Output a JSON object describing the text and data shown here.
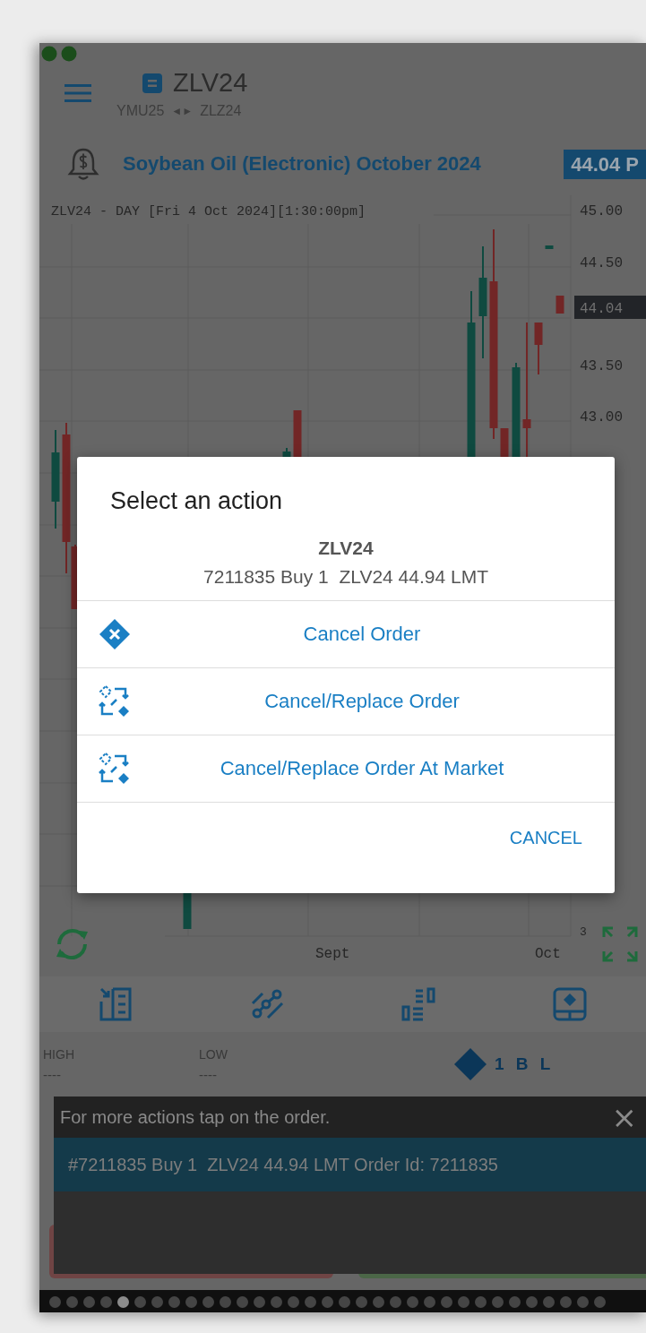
{
  "header": {
    "symbol": "ZLV24",
    "prev_symbol": "YMU25",
    "nav_arrows": "◄►",
    "next_symbol": "ZLZ24"
  },
  "instrument": {
    "name": "Soybean Oil (Electronic) October 2024",
    "price": "44.04 P"
  },
  "chart": {
    "title": "ZLV24 - DAY [Fri 4 Oct 2024][1:30:00pm]",
    "y_labels": [
      "45.00",
      "44.50",
      "43.50",
      "43.00"
    ],
    "current_price": "44.04",
    "x_labels": [
      "Sept",
      "Oct"
    ],
    "corner_label": "3"
  },
  "stats": [
    {
      "label": "HIGH",
      "value": "----"
    },
    {
      "label": "LOW",
      "value": "----"
    }
  ],
  "position": "1 B L",
  "snackbar": {
    "message": "For more actions tap on the order.",
    "close": "×",
    "orders": [
      {
        "text": "#7211835 Buy 1  ZLV24 44.94 LMT Order Id: 7211835",
        "selected": true
      }
    ]
  },
  "pager": {
    "dots": [
      {
        "selected": false
      },
      {
        "selected": false
      },
      {
        "selected": false
      },
      {
        "selected": false
      },
      {
        "selected": true
      },
      {
        "selected": false
      },
      {
        "selected": false
      },
      {
        "selected": false
      },
      {
        "selected": false
      },
      {
        "selected": false
      },
      {
        "selected": false
      },
      {
        "selected": false
      },
      {
        "selected": false
      },
      {
        "selected": false
      },
      {
        "selected": false
      },
      {
        "selected": false
      },
      {
        "selected": false
      },
      {
        "selected": false
      },
      {
        "selected": false
      },
      {
        "selected": false
      },
      {
        "selected": false
      },
      {
        "selected": false
      },
      {
        "selected": false
      },
      {
        "selected": false
      },
      {
        "selected": false
      },
      {
        "selected": false
      },
      {
        "selected": false
      },
      {
        "selected": false
      },
      {
        "selected": false
      },
      {
        "selected": false
      },
      {
        "selected": false
      },
      {
        "selected": false
      },
      {
        "selected": false
      }
    ]
  },
  "dialog": {
    "title": "Select an action",
    "symbol": "ZLV24",
    "order": "7211835 Buy 1  ZLV24 44.94 LMT",
    "actions": [
      {
        "kind": "cancel",
        "label": "Cancel Order"
      },
      {
        "kind": "replace",
        "label": "Cancel/Replace Order"
      },
      {
        "kind": "replace",
        "label": "Cancel/Replace Order At Market"
      }
    ],
    "dismiss": "CANCEL"
  }
}
